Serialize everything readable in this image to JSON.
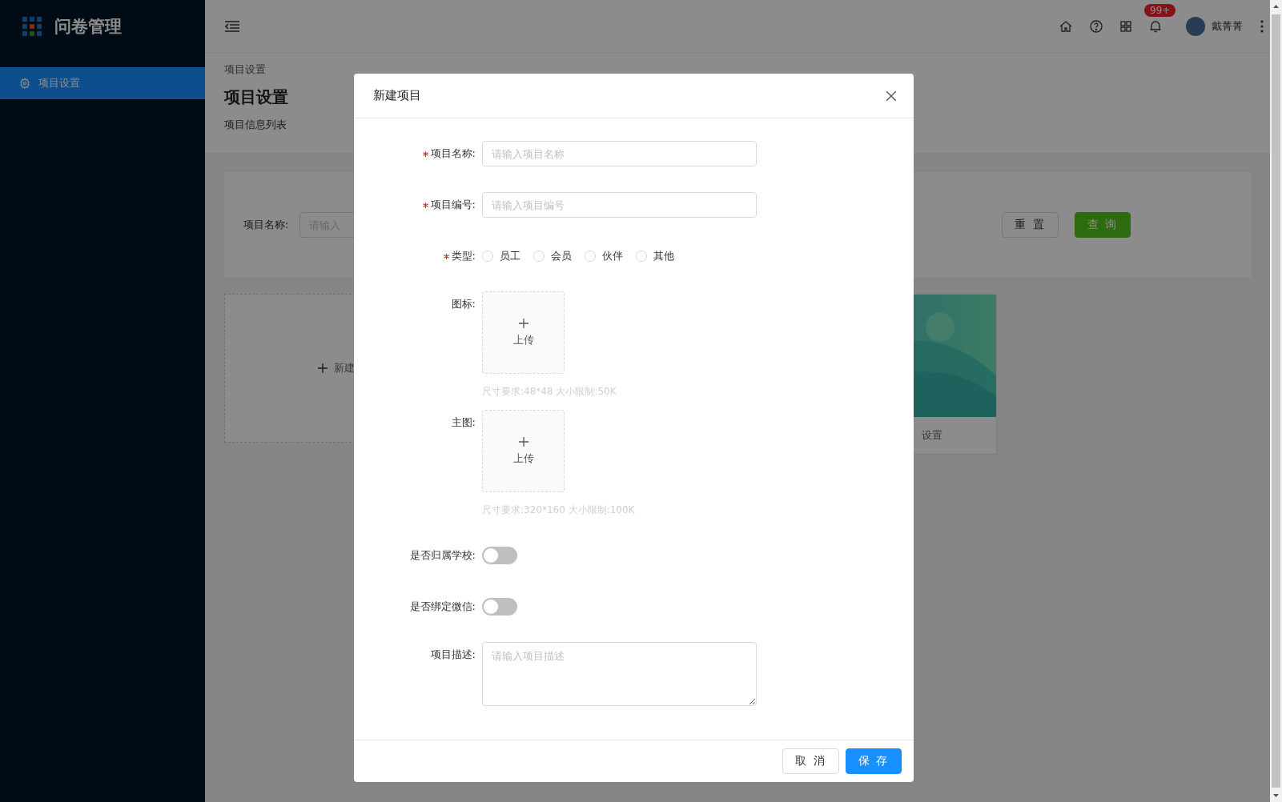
{
  "sidebar": {
    "logo_text": "问卷管理",
    "items": [
      {
        "label": "项目设置",
        "selected": true
      }
    ]
  },
  "header": {
    "notification_badge": "99+",
    "user_name": "戴菁菁"
  },
  "page": {
    "breadcrumb": "项目设置",
    "title": "项目设置",
    "subtitle": "项目信息列表"
  },
  "search": {
    "label": "项目名称:",
    "placeholder": "请输入",
    "buttons": [
      {
        "label": "重 置",
        "kind": "default"
      },
      {
        "label": "查 询",
        "kind": "primary"
      }
    ]
  },
  "cards": [
    {
      "kind": "new",
      "label": "新建"
    },
    {
      "kind": "project",
      "actions": [
        "设置"
      ]
    }
  ],
  "modal": {
    "title": "新建项目",
    "fields": [
      {
        "kind": "input",
        "label": "项目名称:",
        "required": true,
        "placeholder": "请输入项目名称"
      },
      {
        "kind": "input",
        "label": "项目编号:",
        "required": true,
        "placeholder": "请输入项目编号"
      },
      {
        "kind": "radio",
        "label": "类型:",
        "required": true,
        "options": [
          {
            "label": "员工",
            "selected": false
          },
          {
            "label": "会员",
            "selected": false
          },
          {
            "label": "伙伴",
            "selected": false
          },
          {
            "label": "其他",
            "selected": false
          }
        ]
      },
      {
        "kind": "upload",
        "label": "图标:",
        "required": false,
        "button": "上传",
        "hint": "尺寸要求:48*48 大小限制:50K"
      },
      {
        "kind": "upload",
        "label": "主图:",
        "required": false,
        "button": "上传",
        "hint": "尺寸要求:320*160 大小限制:100K"
      },
      {
        "kind": "switch",
        "label": "是否归属学校:",
        "required": false,
        "on": false
      },
      {
        "kind": "switch",
        "label": "是否绑定微信:",
        "required": false,
        "on": false
      },
      {
        "kind": "textarea",
        "label": "项目描述:",
        "required": false,
        "placeholder": "请输入项目描述"
      }
    ],
    "buttons": [
      {
        "label": "取 消",
        "kind": "default"
      },
      {
        "label": "保 存",
        "kind": "primary"
      }
    ]
  }
}
